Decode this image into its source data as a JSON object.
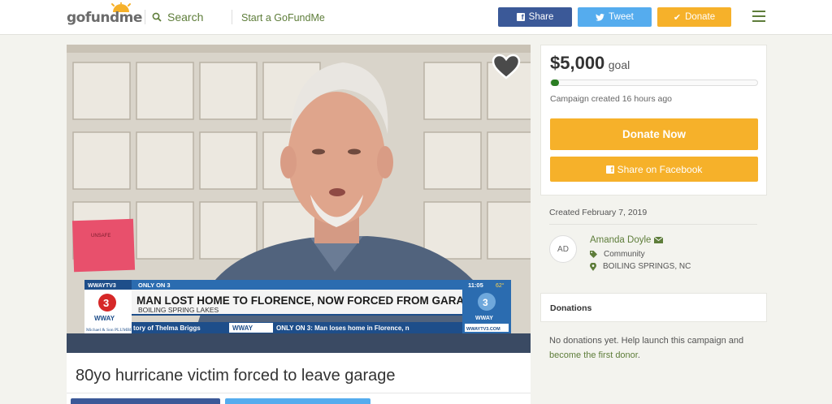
{
  "header": {
    "logo_text": "gofundme",
    "search_label": "Search",
    "start_label": "Start a GoFundMe",
    "share_label": "Share",
    "tweet_label": "Tweet",
    "donate_label": "Donate",
    "colors": {
      "facebook": "#3b5998",
      "twitter": "#55acee",
      "donate": "#f6b12a",
      "brand_green": "#5e7d3a"
    }
  },
  "media": {
    "news_channel_tag": "WWAYTV3",
    "news_only_on": "ONLY ON 3",
    "news_time": "11:05",
    "news_temp": "62°",
    "news_headline": "MAN LOST HOME TO FLORENCE, NOW FORCED FROM GARAGE",
    "news_location": "BOILING SPRING LAKES",
    "news_ticker_left": "tory of Thelma Briggs",
    "news_ticker_brand": "WWAY",
    "news_ticker_right": "ONLY ON 3: Man loses home in Florence, n",
    "news_sponsor": "Michael & Son PLUMBING",
    "news_small_logo": "WWAY",
    "news_url": "WWAYTV3.COM",
    "sign_text": "UNSAFE"
  },
  "campaign": {
    "title": "80yo hurricane victim forced to leave garage"
  },
  "goal_card": {
    "amount": "$5,000",
    "goal_label": "goal",
    "progress": 0.04,
    "created_ago": "Campaign created 16 hours ago",
    "donate_now_label": "Donate Now",
    "share_facebook_label": "Share on Facebook"
  },
  "organizer": {
    "created_date": "Created February 7, 2019",
    "initials": "AD",
    "name": "Amanda Doyle",
    "category": "Community",
    "location": "BOILING SPRINGS, NC"
  },
  "donations": {
    "title": "Donations",
    "empty_text": "No donations yet. Help launch this campaign and",
    "empty_link": "become the first donor",
    "empty_suffix": "."
  }
}
